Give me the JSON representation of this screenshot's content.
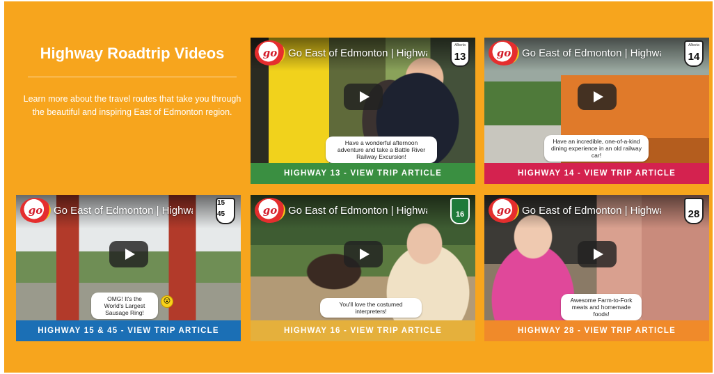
{
  "section": {
    "title": "Highway Roadtrip Videos",
    "description": "Learn more about the travel routes that take you through the beautiful and inspiring East of Edmonton region."
  },
  "colors": {
    "background": "#f7a51d",
    "hw13": "#3a8f41",
    "hw14": "#d4224f",
    "hw1545": "#1b6fb5",
    "hw16": "#e5b03c",
    "hw28": "#f08a2a"
  },
  "videos": [
    {
      "logo_text": "go",
      "video_title": "Go East of Edmonton | Highway...",
      "shield_tag": "Alberta",
      "shield_number": "13",
      "caption": "Have a wonderful afternoon adventure and take a Battle River Railway Excursion!",
      "emoji": "",
      "link_label": "HIGHWAY 13 - VIEW TRIP ARTICLE"
    },
    {
      "logo_text": "go",
      "video_title": "Go East of Edmonton | Highway...",
      "shield_tag": "Alberta",
      "shield_number": "14",
      "caption": "Have an incredible, one-of-a-kind dining experience in an old railway car!",
      "emoji": "",
      "link_label": "HIGHWAY 14 - VIEW TRIP ARTICLE"
    },
    {
      "logo_text": "go",
      "video_title": "Go East of Edmonton | Highway...",
      "shield_tag": "",
      "shield_number": "15 45",
      "caption": "OMG! It's the World's Largest Sausage Ring!",
      "emoji": "😮",
      "link_label": "HIGHWAY 15 & 45 - VIEW TRIP ARTICLE"
    },
    {
      "logo_text": "go",
      "video_title": "Go East of Edmonton | Highway...",
      "shield_tag": "",
      "shield_number": "16",
      "caption": "You'll love the costumed interpreters!",
      "emoji": "",
      "link_label": "HIGHWAY 16 - VIEW TRIP ARTICLE"
    },
    {
      "logo_text": "go",
      "video_title": "Go East of Edmonton | Highway...",
      "shield_tag": "",
      "shield_number": "28",
      "caption": "Awesome Farm-to-Fork meats and homemade foods!",
      "emoji": "",
      "link_label": "HIGHWAY 28 - VIEW TRIP ARTICLE"
    }
  ]
}
